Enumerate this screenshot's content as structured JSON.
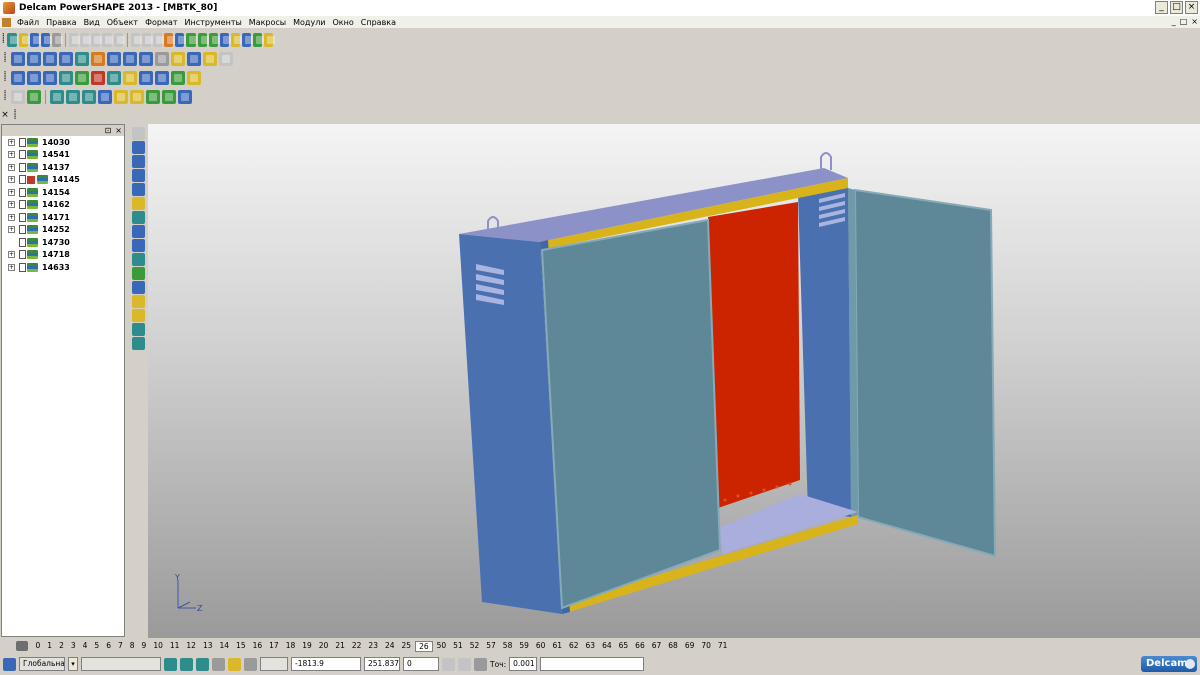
{
  "window": {
    "title": "Delcam PowerSHAPE 2013 - [MBTK_80]",
    "buttons": [
      "_",
      "□",
      "×"
    ]
  },
  "menu": {
    "items": [
      "Файл",
      "Правка",
      "Вид",
      "Объект",
      "Формат",
      "Инструменты",
      "Макросы",
      "Модули",
      "Окно",
      "Справка"
    ],
    "mdi_buttons": [
      "_",
      "□",
      "×"
    ]
  },
  "tree": {
    "header_buttons": [
      "⊡",
      "×"
    ],
    "items": [
      {
        "label": "14030",
        "expandable": true,
        "flag": false
      },
      {
        "label": "14541",
        "expandable": true,
        "flag": false
      },
      {
        "label": "14137",
        "expandable": true,
        "flag": false
      },
      {
        "label": "14145",
        "expandable": true,
        "flag": true
      },
      {
        "label": "14154",
        "expandable": true,
        "flag": false
      },
      {
        "label": "14162",
        "expandable": true,
        "flag": false
      },
      {
        "label": "14171",
        "expandable": true,
        "flag": false
      },
      {
        "label": "14252",
        "expandable": true,
        "flag": false
      },
      {
        "label": "14730",
        "expandable": false,
        "flag": false
      },
      {
        "label": "14718",
        "expandable": true,
        "flag": false
      },
      {
        "label": "14633",
        "expandable": true,
        "flag": false
      }
    ]
  },
  "viewport": {
    "axis_labels": {
      "y": "Y",
      "z": "Z"
    },
    "colors": {
      "cabinet_side": "#4a70b0",
      "cabinet_top": "#8c92c8",
      "door_panel": "#5e8898",
      "back_panel": "#cc2400",
      "trim": "#d8b41a",
      "background_top": "#f4f4f4",
      "background_bottom": "#9a9a9a"
    }
  },
  "levels": {
    "numbers": [
      "0",
      "1",
      "2",
      "3",
      "4",
      "5",
      "6",
      "7",
      "8",
      "9",
      "10",
      "11",
      "12",
      "13",
      "14",
      "15",
      "16",
      "17",
      "18",
      "19",
      "20",
      "21",
      "22",
      "23",
      "24",
      "25",
      "26",
      "50",
      "51",
      "52",
      "57",
      "58",
      "59",
      "60",
      "61",
      "62",
      "63",
      "64",
      "65",
      "66",
      "67",
      "68",
      "69",
      "70",
      "71"
    ],
    "active": "26"
  },
  "status": {
    "workplane": "Глобальна",
    "coord_x": "-1813.9",
    "coord_y": "251.837",
    "coord_z": "0",
    "tolerance_label": "Точ:",
    "tolerance_value": "0.001",
    "brand": "Delcam"
  }
}
